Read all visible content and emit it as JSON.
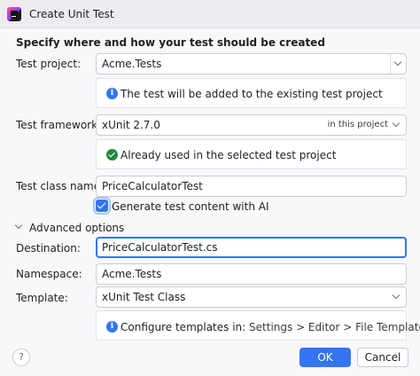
{
  "window": {
    "title": "Create Unit Test",
    "app_icon": "rider-app-icon"
  },
  "heading": "Specify where and how your test should be created",
  "test_project": {
    "label": "Test project:",
    "value": "Acme.Tests",
    "info": "The test will be added to the existing test project"
  },
  "test_framework": {
    "label": "Test framework:",
    "value": "xUnit 2.7.0",
    "hint": "in this project",
    "info": "Already used in the selected test project"
  },
  "test_class": {
    "label": "Test class name:",
    "value": "PriceCalculatorTest"
  },
  "generate_ai": {
    "label": "Generate test content with AI",
    "checked": true
  },
  "advanced": {
    "label": "Advanced options",
    "expanded": true,
    "destination": {
      "label": "Destination:",
      "value": "PriceCalculatorTest.cs"
    },
    "namespace": {
      "label": "Namespace:",
      "value": "Acme.Tests"
    },
    "template": {
      "label": "Template:",
      "value": "xUnit Test Class"
    },
    "configure": {
      "prefix": "Configure templates in:",
      "path": "Settings > Editor > File Templates"
    }
  },
  "buttons": {
    "help": "?",
    "ok": "OK",
    "cancel": "Cancel"
  },
  "colors": {
    "accent": "#3574f0",
    "success": "#208a3c",
    "background": "#f7f8fa"
  }
}
